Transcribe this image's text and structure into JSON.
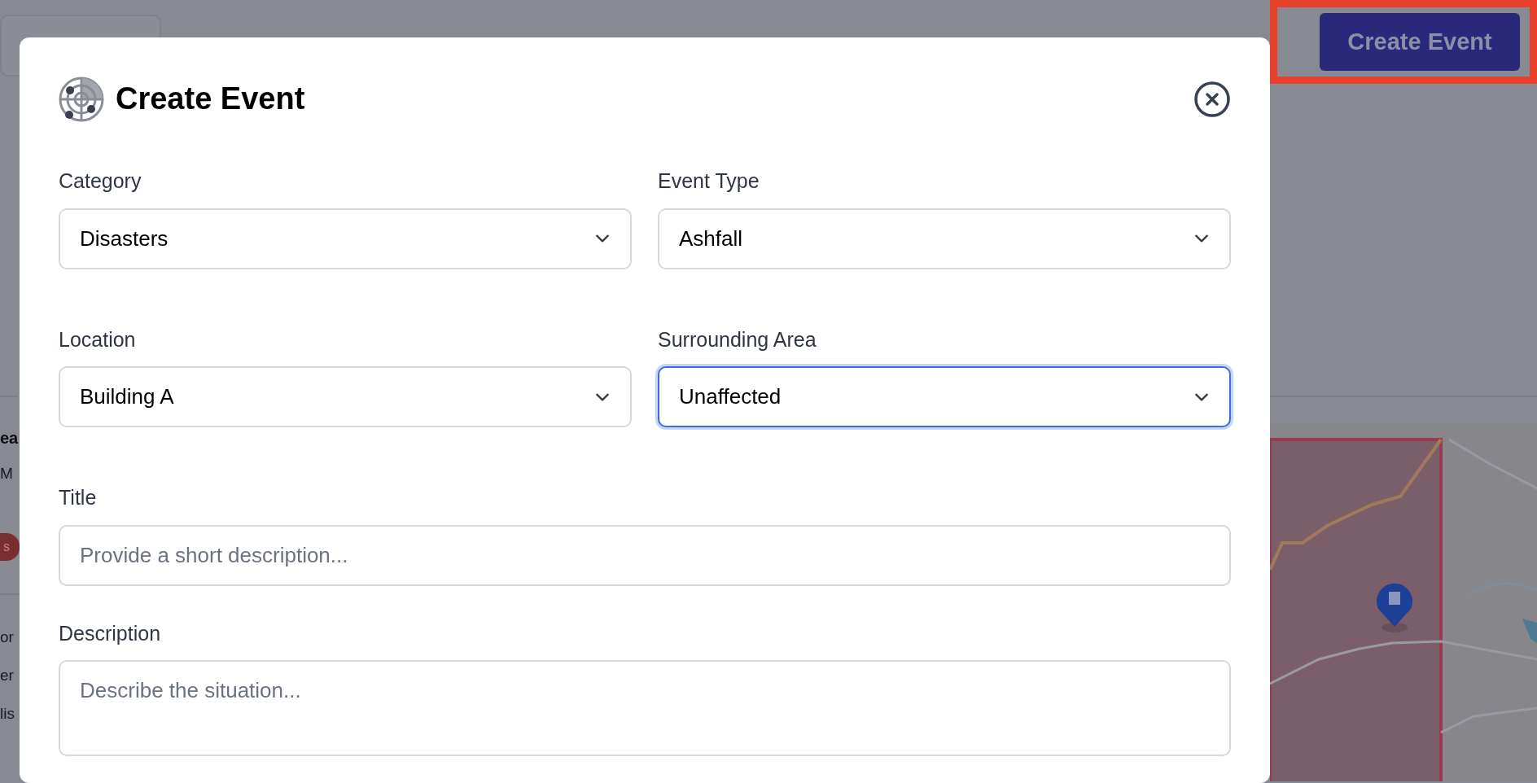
{
  "background": {
    "create_button": {
      "label": "Create Event",
      "highlighted": true
    },
    "left_strip": [
      {
        "kind": "heading",
        "text": "ea"
      },
      {
        "kind": "text",
        "text": "M"
      },
      {
        "kind": "badge",
        "text": "s",
        "color": "#7a2e2e"
      },
      {
        "kind": "divider"
      },
      {
        "kind": "text",
        "text": "or"
      },
      {
        "kind": "text",
        "text": "er"
      },
      {
        "kind": "text",
        "text": "lis"
      }
    ]
  },
  "modal": {
    "title": "Create Event",
    "fields": [
      {
        "kind": "select",
        "label": "Category",
        "value": "Disasters",
        "focused": false
      },
      {
        "kind": "select",
        "label": "Event Type",
        "value": "Ashfall",
        "focused": false
      },
      {
        "kind": "select",
        "label": "Location",
        "value": "Building A",
        "focused": false
      },
      {
        "kind": "select",
        "label": "Surrounding Area",
        "value": "Unaffected",
        "focused": true
      },
      {
        "kind": "input",
        "label": "Title",
        "placeholder": "Provide a short description...",
        "focused": false
      },
      {
        "kind": "textarea",
        "label": "Description",
        "placeholder": "Describe the situation...",
        "focused": false
      }
    ]
  }
}
